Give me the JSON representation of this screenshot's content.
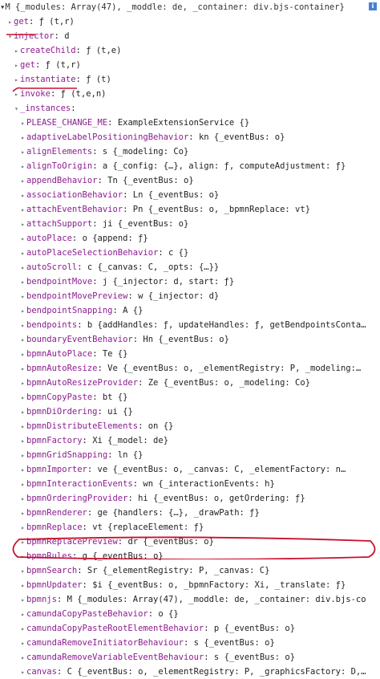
{
  "header": {
    "text": "▾M {_modules: Array(47), _moddle: de, _container: div.bjs-container}",
    "info": "i"
  },
  "rows": [
    {
      "indent": 1,
      "tri": "▸",
      "key": "get",
      "val": "ƒ (t,r)"
    },
    {
      "indent": 1,
      "tri": "▾",
      "key": "injector",
      "val": "d"
    },
    {
      "indent": 2,
      "tri": "▸",
      "key": "createChild",
      "val": "ƒ (t,e)"
    },
    {
      "indent": 2,
      "tri": "▸",
      "key": "get",
      "val": "ƒ (t,r)"
    },
    {
      "indent": 2,
      "tri": "▸",
      "key": "instantiate",
      "val": "ƒ (t)"
    },
    {
      "indent": 2,
      "tri": "▸",
      "key": "invoke",
      "val": "ƒ (t,e,n)"
    },
    {
      "indent": 2,
      "tri": "▾",
      "key": "_instances",
      "val": ""
    },
    {
      "indent": 3,
      "tri": "▸",
      "key": "PLEASE_CHANGE_ME",
      "val": "ExampleExtensionService {}"
    },
    {
      "indent": 3,
      "tri": "▸",
      "key": "adaptiveLabelPositioningBehavior",
      "val": "kn {_eventBus: o}"
    },
    {
      "indent": 3,
      "tri": "▸",
      "key": "alignElements",
      "val": "s {_modeling: Co}"
    },
    {
      "indent": 3,
      "tri": "▸",
      "key": "alignToOrigin",
      "val": "a {_config: {…}, align: ƒ, computeAdjustment: ƒ}"
    },
    {
      "indent": 3,
      "tri": "▸",
      "key": "appendBehavior",
      "val": "Tn {_eventBus: o}"
    },
    {
      "indent": 3,
      "tri": "▸",
      "key": "associationBehavior",
      "val": "Ln {_eventBus: o}"
    },
    {
      "indent": 3,
      "tri": "▸",
      "key": "attachEventBehavior",
      "val": "Pn {_eventBus: o, _bpmnReplace: vt}"
    },
    {
      "indent": 3,
      "tri": "▸",
      "key": "attachSupport",
      "val": "ji {_eventBus: o}"
    },
    {
      "indent": 3,
      "tri": "▸",
      "key": "autoPlace",
      "val": "o {append: ƒ}"
    },
    {
      "indent": 3,
      "tri": "▸",
      "key": "autoPlaceSelectionBehavior",
      "val": "c {}"
    },
    {
      "indent": 3,
      "tri": "▸",
      "key": "autoScroll",
      "val": "c {_canvas: C, _opts: {…}}"
    },
    {
      "indent": 3,
      "tri": "▸",
      "key": "bendpointMove",
      "val": "j {_injector: d, start: ƒ}"
    },
    {
      "indent": 3,
      "tri": "▸",
      "key": "bendpointMovePreview",
      "val": "w {_injector: d}"
    },
    {
      "indent": 3,
      "tri": "▸",
      "key": "bendpointSnapping",
      "val": "A {}"
    },
    {
      "indent": 3,
      "tri": "▸",
      "key": "bendpoints",
      "val": "b {addHandles: ƒ, updateHandles: ƒ, getBendpointsConta…"
    },
    {
      "indent": 3,
      "tri": "▸",
      "key": "boundaryEventBehavior",
      "val": "Hn {_eventBus: o}"
    },
    {
      "indent": 3,
      "tri": "▸",
      "key": "bpmnAutoPlace",
      "val": "Te {}"
    },
    {
      "indent": 3,
      "tri": "▸",
      "key": "bpmnAutoResize",
      "val": "Ve {_eventBus: o, _elementRegistry: P, _modeling:…"
    },
    {
      "indent": 3,
      "tri": "▸",
      "key": "bpmnAutoResizeProvider",
      "val": "Ze {_eventBus: o, _modeling: Co}"
    },
    {
      "indent": 3,
      "tri": "▸",
      "key": "bpmnCopyPaste",
      "val": "bt {}"
    },
    {
      "indent": 3,
      "tri": "▸",
      "key": "bpmnDiOrdering",
      "val": "ui {}"
    },
    {
      "indent": 3,
      "tri": "▸",
      "key": "bpmnDistributeElements",
      "val": "on {}"
    },
    {
      "indent": 3,
      "tri": "▸",
      "key": "bpmnFactory",
      "val": "Xi {_model: de}"
    },
    {
      "indent": 3,
      "tri": "▸",
      "key": "bpmnGridSnapping",
      "val": "ln {}"
    },
    {
      "indent": 3,
      "tri": "▸",
      "key": "bpmnImporter",
      "val": "ve {_eventBus: o, _canvas: C, _elementFactory: n…"
    },
    {
      "indent": 3,
      "tri": "▸",
      "key": "bpmnInteractionEvents",
      "val": "wn {_interactionEvents: h}"
    },
    {
      "indent": 3,
      "tri": "▸",
      "key": "bpmnOrderingProvider",
      "val": "hi {_eventBus: o, getOrdering: ƒ}"
    },
    {
      "indent": 3,
      "tri": "▸",
      "key": "bpmnRenderer",
      "val": "ge {handlers: {…}, _drawPath: ƒ}"
    },
    {
      "indent": 3,
      "tri": "▸",
      "key": "bpmnReplace",
      "val": "vt {replaceElement: ƒ}"
    },
    {
      "indent": 3,
      "tri": "▸",
      "key": "bpmnReplacePreview",
      "val": "dr {_eventBus: o}"
    },
    {
      "indent": 3,
      "tri": "▸",
      "key": "bpmnRules",
      "val": "g {_eventBus: o}"
    },
    {
      "indent": 3,
      "tri": "▸",
      "key": "bpmnSearch",
      "val": "Sr {_elementRegistry: P, _canvas: C}"
    },
    {
      "indent": 3,
      "tri": "▸",
      "key": "bpmnUpdater",
      "val": "$i {_eventBus: o, _bpmnFactory: Xi, _translate: ƒ}"
    },
    {
      "indent": 3,
      "tri": "▸",
      "key": "bpmnjs",
      "val": "M {_modules: Array(47), _moddle: de, _container: div.bjs-co"
    },
    {
      "indent": 3,
      "tri": "▸",
      "key": "camundaCopyPasteBehavior",
      "val": "o {}"
    },
    {
      "indent": 3,
      "tri": "▸",
      "key": "camundaCopyPasteRootElementBehavior",
      "val": "p {_eventBus: o}"
    },
    {
      "indent": 3,
      "tri": "▸",
      "key": "camundaRemoveInitiatorBehaviour",
      "val": "s {_eventBus: o}"
    },
    {
      "indent": 3,
      "tri": "▸",
      "key": "camundaRemoveVariableEventBehaviour",
      "val": "s {_eventBus: o}"
    },
    {
      "indent": 3,
      "tri": "▸",
      "key": "canvas",
      "val": "C {_eventBus: o, _elementRegistry: P, _graphicsFactory: D,…"
    }
  ],
  "annotation_color": "#c8102e"
}
